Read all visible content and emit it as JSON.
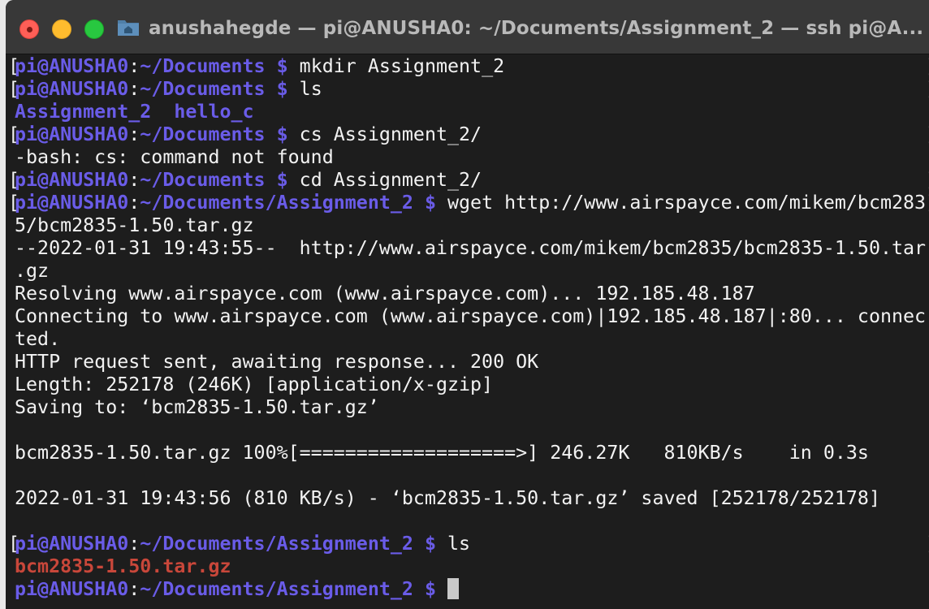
{
  "window": {
    "title": "anushahegde — pi@ANUSHA0: ~/Documents/Assignment_2 — ssh pi@A..."
  },
  "colors": {
    "prompt": "#6a5ce8",
    "directory": "#6a5ce8",
    "archive": "#c9473a",
    "text": "#f2f2f2",
    "background": "#1d1d1d"
  },
  "prompt": {
    "user_host": "pi@ANUSHA0",
    "colon": ":",
    "path_docs": "~/Documents",
    "path_assign": "~/Documents/Assignment_2",
    "dollar": " $ "
  },
  "lines": {
    "l1_cmd": "mkdir Assignment_2",
    "l2_cmd": "ls",
    "l3_dir1": "Assignment_2",
    "l3_dir2": "hello_c",
    "l4_cmd": "cs Assignment_2/",
    "l5_out": "-bash: cs: command not found",
    "l6_cmd": "cd Assignment_2/",
    "l7_cmd": "wget http://www.airspayce.com/mikem/bcm283",
    "l8_out": "5/bcm2835-1.50.tar.gz",
    "l9_out": "--2022-01-31 19:43:55--  http://www.airspayce.com/mikem/bcm2835/bcm2835-1.50.tar",
    "l10_out": ".gz",
    "l11_out": "Resolving www.airspayce.com (www.airspayce.com)... 192.185.48.187",
    "l12_out": "Connecting to www.airspayce.com (www.airspayce.com)|192.185.48.187|:80... connec",
    "l13_out": "ted.",
    "l14_out": "HTTP request sent, awaiting response... 200 OK",
    "l15_out": "Length: 252178 (246K) [application/x-gzip]",
    "l16_out": "Saving to: ‘bcm2835-1.50.tar.gz’",
    "l18_out": "bcm2835-1.50.tar.gz 100%[===================>] 246.27K   810KB/s    in 0.3s",
    "l20_out": "2022-01-31 19:43:56 (810 KB/s) - ‘bcm2835-1.50.tar.gz’ saved [252178/252178]",
    "l22_cmd": "ls",
    "l23_file": "bcm2835-1.50.tar.gz"
  },
  "progress": {
    "percent": 100
  },
  "edge_marks": {
    "left": "[",
    "right": "]"
  }
}
